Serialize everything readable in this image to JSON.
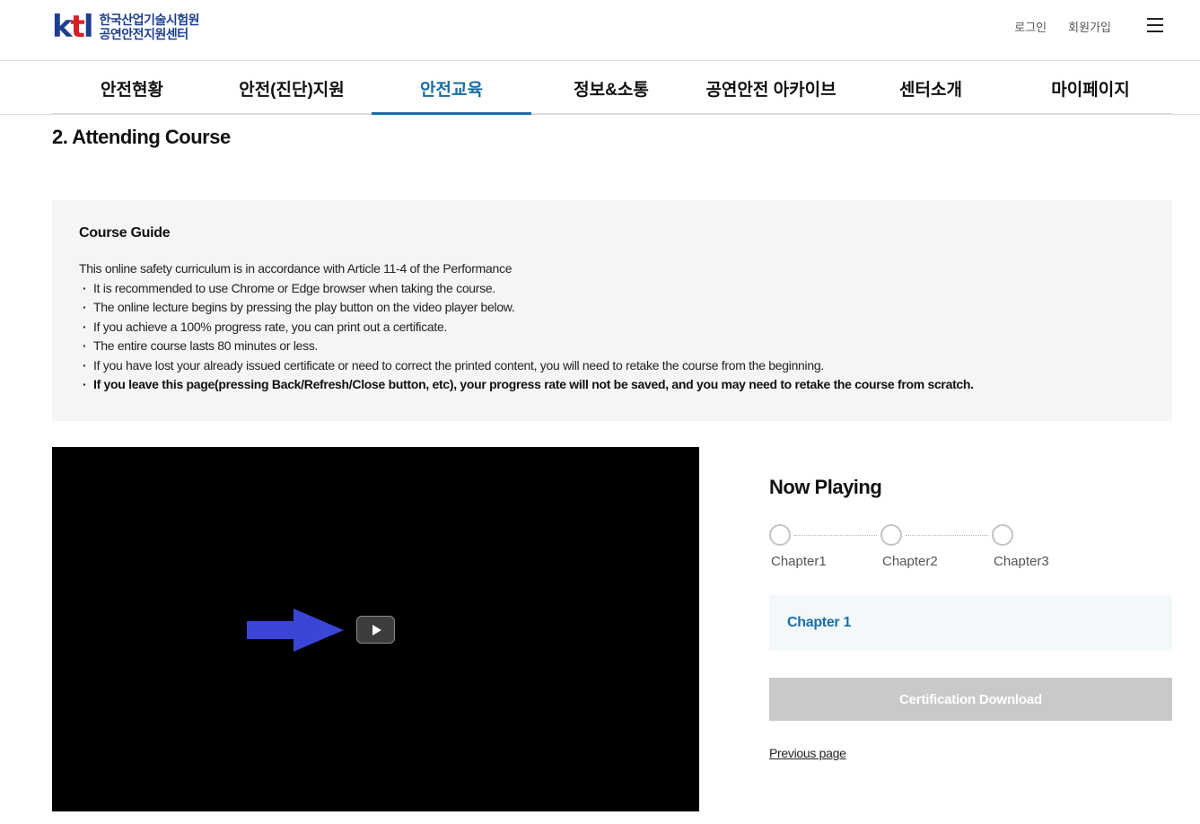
{
  "header": {
    "logo_mark": "ktl",
    "logo_line1": "한국산업기술시험원",
    "logo_line2": "공연안전지원센터",
    "login": "로그인",
    "signup": "회원가입",
    "menu_icon": "hamburger-icon"
  },
  "nav": {
    "items": [
      {
        "label": "안전현황"
      },
      {
        "label": "안전(진단)지원"
      },
      {
        "label": "안전교육",
        "active": true
      },
      {
        "label": "정보&소통"
      },
      {
        "label": "공연안전 아카이브"
      },
      {
        "label": "센터소개"
      },
      {
        "label": "마이페이지"
      }
    ],
    "active_color": "#1a6ea6"
  },
  "page": {
    "title": "2. Attending Course"
  },
  "guide": {
    "title": "Course Guide",
    "intro": "This online safety curriculum is in accordance with Article 11-4 of the Performance",
    "items": [
      "It is recommended to use Chrome or Edge browser when taking the course.",
      "The online lecture begins by pressing the play button on the video player below.",
      "If you achieve a 100% progress rate, you can print out a certificate.",
      "The entire course lasts 80 minutes or less.",
      "If you have lost your already issued certificate or need to correct the printed content, you will need to retake the course from the beginning.",
      "If you leave this page(pressing Back/Refresh/Close button, etc), your progress rate will not be saved, and you may need to retake the course from scratch."
    ]
  },
  "video": {
    "play_icon": "play-icon",
    "arrow_icon": "arrow-right-icon",
    "arrow_color": "#3a46d6"
  },
  "player_panel": {
    "now_playing": "Now Playing",
    "chapters": [
      "Chapter1",
      "Chapter2",
      "Chapter3"
    ],
    "current_chapter": "Chapter 1",
    "cert_button": "Certification Download",
    "previous_page": "Previous page"
  }
}
